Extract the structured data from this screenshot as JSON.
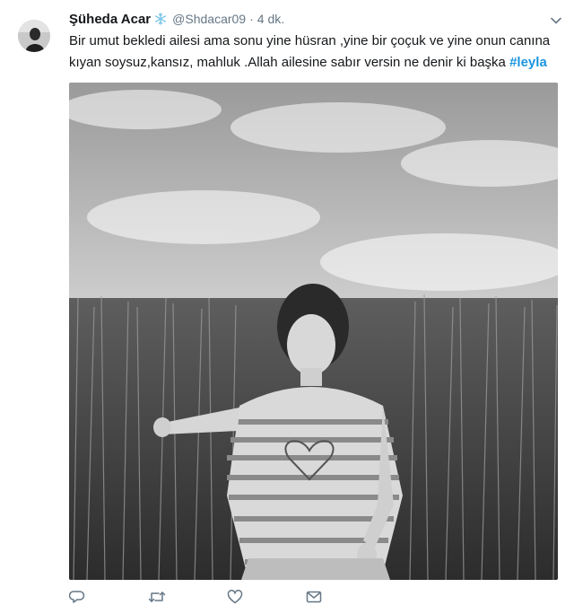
{
  "tweet": {
    "author_name": "Şüheda Acar",
    "badge_icon": "snowflake-icon",
    "handle": "@Shdacar09",
    "separator": "·",
    "time": "4 dk.",
    "text": "Bir umut bekledi ailesi ama sonu yine hüsran ,yine bir çoçuk ve yine onun canına kıyan soysuz,kansız, mahluk .Allah ailesine sabır versin ne denir ki başka ",
    "hashtag": "#leyla",
    "photo_icon": "girl-in-wheat-field-photo"
  },
  "actions": {
    "icons": [
      "reply-icon",
      "retweet-icon",
      "like-icon",
      "message-icon"
    ]
  },
  "colors": {
    "text": "#14171a",
    "secondary": "#657786",
    "link": "#1b95e0",
    "snowflake": "#7ec7ea"
  }
}
